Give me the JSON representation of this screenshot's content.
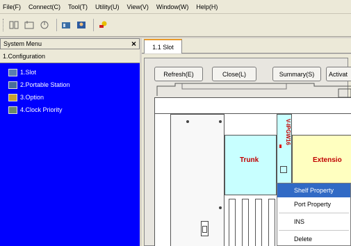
{
  "menubar": {
    "items": [
      "File(F)",
      "Connect(C)",
      "Tool(T)",
      "Utility(U)",
      "View(V)",
      "Window(W)",
      "Help(H)"
    ]
  },
  "toolbar": {
    "icons": [
      "connect-icon",
      "disconnect-icon",
      "refresh-config-icon",
      "module-icon",
      "user-icon",
      "key-icon"
    ]
  },
  "system_menu": {
    "title": "System Menu",
    "close": "×",
    "section": "1.Configuration",
    "items": [
      {
        "label": "1.Slot",
        "icon": "slot-icon"
      },
      {
        "label": "2.Portable Station",
        "icon": "portable-station-icon"
      },
      {
        "label": "3.Option",
        "icon": "option-icon"
      },
      {
        "label": "4.Clock Priority",
        "icon": "clock-priority-icon"
      }
    ]
  },
  "tab": {
    "label": "1.1 Slot"
  },
  "buttons": {
    "refresh": "Refresh(E)",
    "close": "Close(L)",
    "summary": "Summary(S)",
    "activate": "Activat"
  },
  "cabinet": {
    "trunk_label": "Trunk",
    "extension_label": "Extensio",
    "card_label": "V-IPGW16"
  },
  "context_menu": {
    "items": [
      "Shelf Property",
      "Port Property",
      "INS",
      "Delete"
    ],
    "selected": "Shelf Property"
  },
  "colors": {
    "panel_blue": "#0000ff",
    "trunk_cyan": "#c8ffff",
    "extension_yellow": "#ffffc0",
    "tab_accent": "#e89a2a",
    "selection": "#316ac5"
  }
}
